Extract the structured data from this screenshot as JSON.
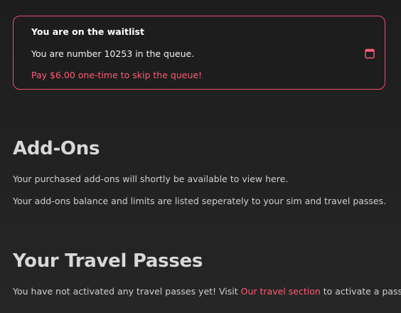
{
  "waitlist": {
    "title": "You are on the waitlist",
    "queue_text": "You are number 10253 in the queue.",
    "pay_link": "Pay $6.00 one-time to skip the queue!",
    "icon": "calendar-icon",
    "accent_color": "#ea4f6e"
  },
  "addons": {
    "heading": "Add-Ons",
    "line1": "Your purchased add-ons will shortly be available to view here.",
    "line2": "Your add-ons balance and limits are listed seperately to your sim and travel passes."
  },
  "travel_passes": {
    "heading": "Your Travel Passes",
    "text_before": "You have not activated any travel passes yet! Visit ",
    "link_text": "Our travel section",
    "text_after": " to activate a pass."
  }
}
